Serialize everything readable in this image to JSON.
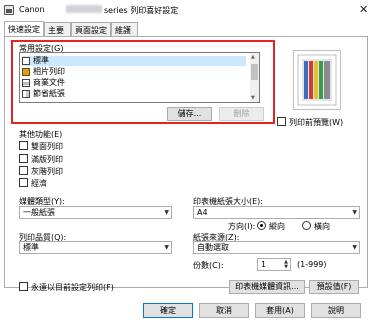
{
  "window": {
    "title_prefix": "Canon",
    "title_suffix": "series 列印喜好設定",
    "close_label": "✕"
  },
  "tabs": [
    {
      "label": "快速設定"
    },
    {
      "label": "主要"
    },
    {
      "label": "頁面設定"
    },
    {
      "label": "維護"
    }
  ],
  "commonly_used": {
    "label": "常用設定(G)",
    "items": [
      {
        "label": "標準",
        "selected": true
      },
      {
        "label": "相片列印",
        "selected": false
      },
      {
        "label": "商業文件",
        "selected": false
      },
      {
        "label": "節省紙張",
        "selected": false
      }
    ],
    "save_label": "儲存...",
    "delete_label": "刪除"
  },
  "preview": {
    "checkbox_label": "列印前預覽(W)"
  },
  "additional": {
    "label": "其他功能(E)",
    "items": [
      {
        "label": "雙面列印"
      },
      {
        "label": "滿版列印"
      },
      {
        "label": "灰階列印"
      },
      {
        "label": "經濟"
      }
    ]
  },
  "media_type": {
    "label": "媒體類型(Y):",
    "value": "一般紙張"
  },
  "paper_size": {
    "label": "印表機紙張大小(E):",
    "value": "A4"
  },
  "orientation": {
    "label": "方向(I):",
    "portrait": "縱向",
    "landscape": "橫向"
  },
  "print_quality": {
    "label": "列印品質(Q):",
    "value": "標準"
  },
  "paper_source": {
    "label": "紙張來源(Z):",
    "value": "自動選取"
  },
  "copies": {
    "label": "份數(C):",
    "value": "1",
    "range": "(1-999)"
  },
  "always_print": {
    "label": "永遠以目前設定列印(F)"
  },
  "buttons": {
    "printer_info": "印表機媒體資訊...",
    "defaults": "預設值(F)",
    "ok": "確定",
    "cancel": "取消",
    "apply": "套用(A)",
    "help": "說明"
  }
}
